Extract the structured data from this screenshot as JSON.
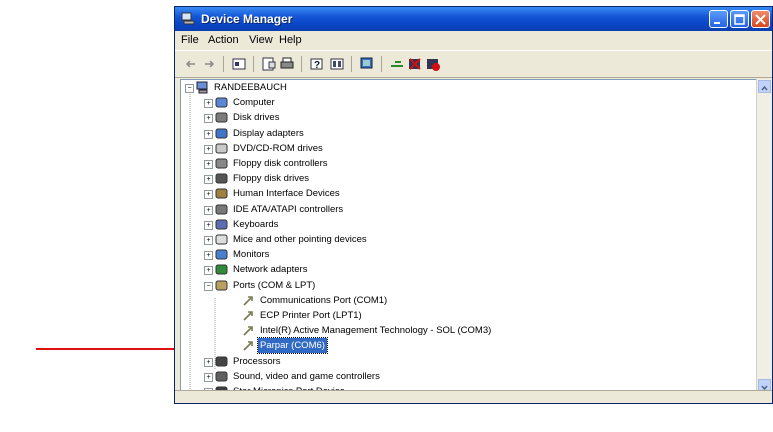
{
  "window": {
    "title": "Device Manager"
  },
  "menu": [
    "File",
    "Action",
    "View",
    "Help"
  ],
  "toolbar_icons": [
    "back-icon",
    "forward-icon",
    "console-icon",
    "properties-icon",
    "print-icon",
    "help-icon",
    "details-icon",
    "scan-hardware-icon",
    "update-driver-icon",
    "uninstall-icon",
    "disable-icon"
  ],
  "tree": {
    "root": "RANDEEBAUCH",
    "items": [
      {
        "label": "Computer",
        "icon": "computer-icon"
      },
      {
        "label": "Disk drives",
        "icon": "disk-drive-icon"
      },
      {
        "label": "Display adapters",
        "icon": "display-icon"
      },
      {
        "label": "DVD/CD-ROM drives",
        "icon": "cd-icon"
      },
      {
        "label": "Floppy disk controllers",
        "icon": "controller-icon"
      },
      {
        "label": "Floppy disk drives",
        "icon": "floppy-icon"
      },
      {
        "label": "Human Interface Devices",
        "icon": "hid-icon"
      },
      {
        "label": "IDE ATA/ATAPI controllers",
        "icon": "ide-icon"
      },
      {
        "label": "Keyboards",
        "icon": "keyboard-icon"
      },
      {
        "label": "Mice and other pointing devices",
        "icon": "mouse-icon"
      },
      {
        "label": "Monitors",
        "icon": "monitor-icon"
      },
      {
        "label": "Network adapters",
        "icon": "network-icon"
      },
      {
        "label": "Ports (COM & LPT)",
        "icon": "port-icon"
      }
    ],
    "port_children": [
      {
        "label": "Communications Port (COM1)"
      },
      {
        "label": "ECP Printer Port (LPT1)"
      },
      {
        "label": "Intel(R) Active Management Technology - SOL (COM3)"
      },
      {
        "label": "Parpar (COM6)"
      }
    ],
    "after": [
      {
        "label": "Processors",
        "icon": "processor-icon"
      },
      {
        "label": "Sound, video and game controllers",
        "icon": "sound-icon"
      },
      {
        "label": "Star Micronics Port Device",
        "icon": "star-port-icon"
      }
    ]
  },
  "colors": {
    "title_blue": "#0a46c8",
    "selection": "#316ac5",
    "annotation_arrow": "#e01010"
  }
}
